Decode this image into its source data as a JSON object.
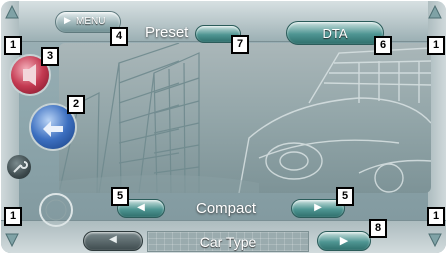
{
  "top": {
    "menu_label": "MENU",
    "preset_label": "Preset",
    "dta_label": "DTA"
  },
  "setting": {
    "value": "Compact"
  },
  "bottom": {
    "title": "Car Type"
  },
  "callouts": {
    "c1_top_left": "1",
    "c1_top_right": "1",
    "c1_bottom_left": "1",
    "c1_bottom_right": "1",
    "c2": "2",
    "c3": "3",
    "c4": "4",
    "c5_left": "5",
    "c5_right": "5",
    "c6": "6",
    "c7": "7",
    "c8": "8"
  },
  "colors": {
    "accent_teal": "#2f7d7a",
    "red_button": "#b3223a",
    "blue_button": "#2d5fb0",
    "frame": "#b5c4c7"
  }
}
